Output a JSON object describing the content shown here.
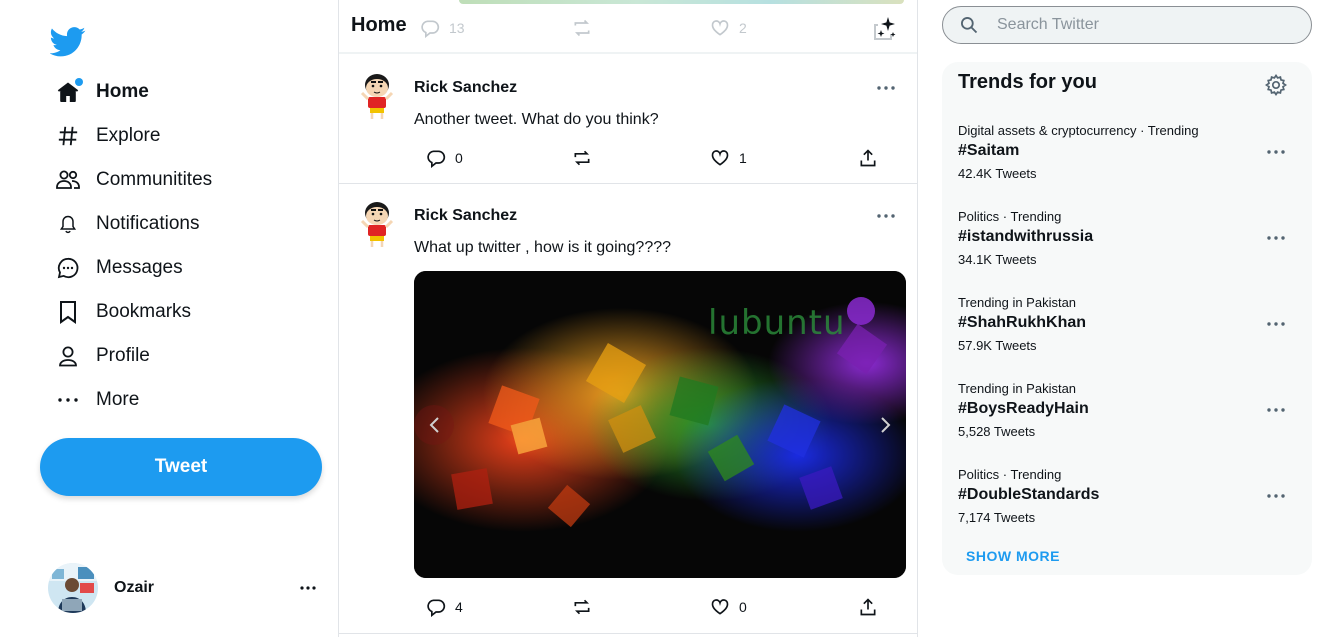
{
  "sidebar": {
    "logo": "twitter-bird-icon",
    "brand_color": "#1d9bf0",
    "nav": [
      {
        "label": "Home",
        "icon": "home-icon",
        "active": true,
        "notification_dot": true
      },
      {
        "label": "Explore",
        "icon": "hashtag-icon"
      },
      {
        "label": "Communitites",
        "icon": "communities-icon"
      },
      {
        "label": "Notifications",
        "icon": "bell-icon"
      },
      {
        "label": "Messages",
        "icon": "messages-icon"
      },
      {
        "label": "Bookmarks",
        "icon": "bookmark-icon"
      },
      {
        "label": "Profile",
        "icon": "profile-icon"
      },
      {
        "label": "More",
        "icon": "more-dots-icon"
      }
    ],
    "tweet_button": "Tweet",
    "account": {
      "name": "Ozair"
    }
  },
  "main": {
    "title": "Home",
    "previous_tweet_stats": {
      "replies": "13",
      "likes": "2"
    },
    "tweets": [
      {
        "author": "Rick Sanchez",
        "text": "Another tweet. What do you think?",
        "replies": "0",
        "likes": "1",
        "has_media": false
      },
      {
        "author": "Rick Sanchez",
        "text": "What up twitter , how is it going????",
        "replies": "4",
        "likes": "0",
        "has_media": true,
        "media_caption": "lubuntu"
      }
    ]
  },
  "right": {
    "search_placeholder": "Search Twitter",
    "trends_title": "Trends for you",
    "trends": [
      {
        "context": "Digital assets & cryptocurrency · Trending",
        "tag": "#Saitam",
        "count": "42.4K Tweets"
      },
      {
        "context": "Politics · Trending",
        "tag": "#istandwithrussia",
        "count": "34.1K Tweets"
      },
      {
        "context": "Trending in Pakistan",
        "tag": "#ShahRukhKhan",
        "count": "57.9K Tweets"
      },
      {
        "context": "Trending in Pakistan",
        "tag": "#BoysReadyHain",
        "count": "5,528 Tweets"
      },
      {
        "context": "Politics · Trending",
        "tag": "#DoubleStandards",
        "count": "7,174 Tweets"
      }
    ],
    "show_more": "SHOW MORE"
  }
}
